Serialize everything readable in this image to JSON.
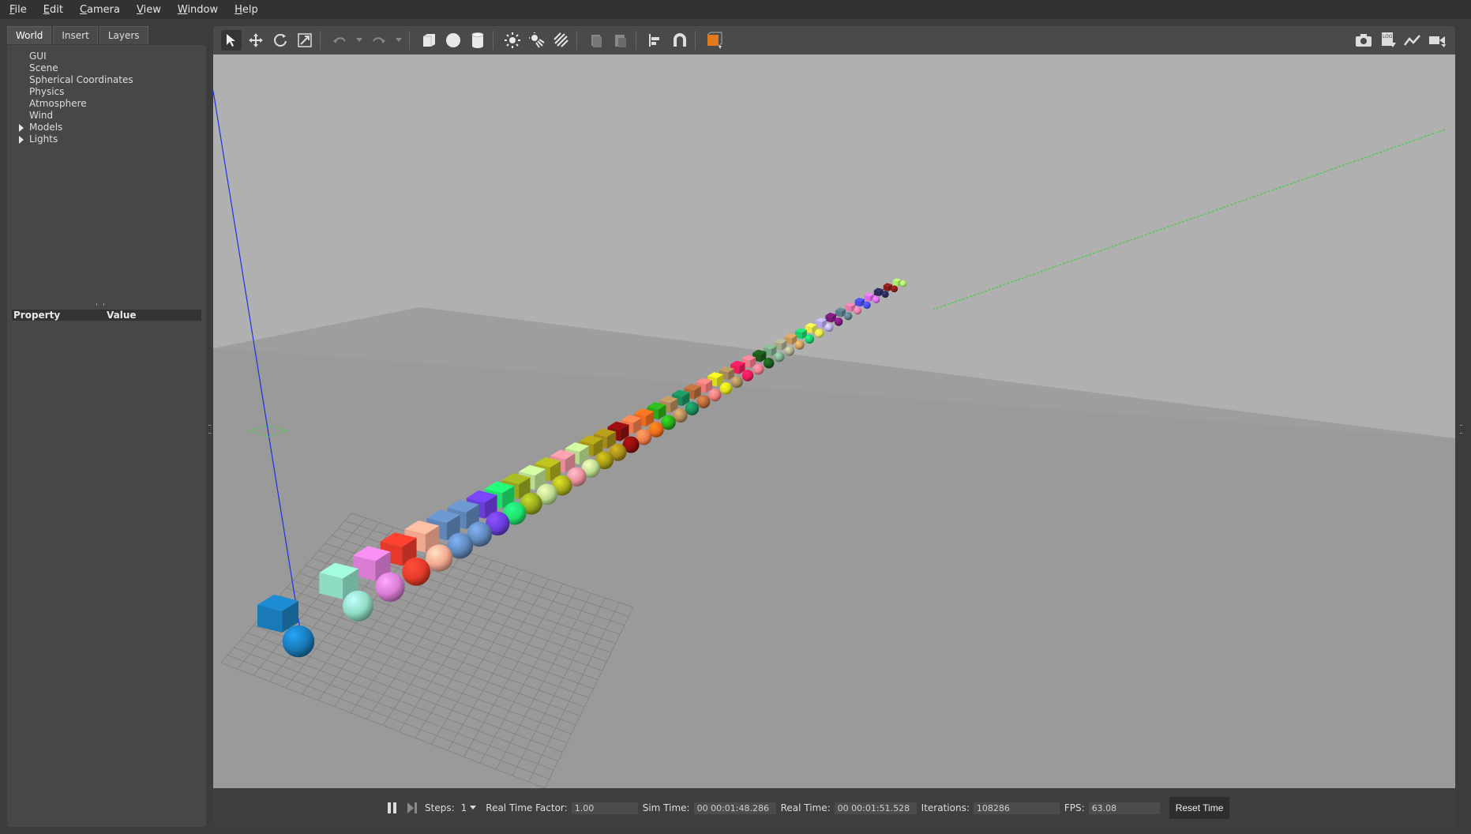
{
  "menu": [
    "File",
    "Edit",
    "Camera",
    "View",
    "Window",
    "Help"
  ],
  "left_panel": {
    "tabs": [
      "World",
      "Insert",
      "Layers"
    ],
    "active_tab": "World",
    "tree": [
      {
        "label": "GUI",
        "expandable": false
      },
      {
        "label": "Scene",
        "expandable": false
      },
      {
        "label": "Spherical Coordinates",
        "expandable": false
      },
      {
        "label": "Physics",
        "expandable": false
      },
      {
        "label": "Atmosphere",
        "expandable": false
      },
      {
        "label": "Wind",
        "expandable": false
      },
      {
        "label": "Models",
        "expandable": true
      },
      {
        "label": "Lights",
        "expandable": true
      }
    ],
    "property_header": {
      "property": "Property",
      "value": "Value"
    }
  },
  "toolbar": {
    "left_icons": [
      "select-icon",
      "translate-icon",
      "rotate-icon",
      "scale-icon",
      "undo-icon",
      "undo-dropdown-icon",
      "redo-icon",
      "redo-dropdown-icon",
      "box-icon",
      "sphere-icon",
      "cylinder-icon",
      "point-light-icon",
      "spot-light-icon",
      "directional-light-icon",
      "copy-icon",
      "paste-icon",
      "align-icon",
      "snap-icon",
      "view-angle-icon"
    ],
    "right_icons": [
      "screenshot-icon",
      "log-icon",
      "plot-icon",
      "record-video-icon"
    ],
    "log_label": "LOG"
  },
  "scene": {
    "sky_color": "#b0b0b0",
    "ground_color": "#999999",
    "model_colors": [
      "#1a7ab8",
      "#8fdcc4",
      "#d97cd4",
      "#e53a2a",
      "#f2a890",
      "#5f86b8",
      "#5f86b8",
      "#6a3ddd",
      "#1fe06a",
      "#96a51f",
      "#b9dc8e",
      "#a7ab1c",
      "#e88e9a",
      "#b9dc8e",
      "#a49616",
      "#a48a1a",
      "#8a0d0d",
      "#ee7a4a",
      "#ee6a1a",
      "#2aa81a",
      "#b0885a",
      "#1a8a5a",
      "#b0683a",
      "#ee7a7a",
      "#dddd1a",
      "#a88a5a",
      "#ee1a5a",
      "#ee7a8a",
      "#1a5a1a",
      "#7aa88a",
      "#a8a88a",
      "#c89a5a",
      "#1acc6a",
      "#e8e84a",
      "#b8a8e8",
      "#7a1a7a",
      "#5a7a8a",
      "#e87aa8",
      "#4a4aee",
      "#dd6aee",
      "#2a2a5a",
      "#8a1a1a",
      "#a8ee6a"
    ]
  },
  "status": {
    "steps_label": "Steps:",
    "steps_value": "1",
    "rtf_label": "Real Time Factor:",
    "rtf_value": "1.00",
    "sim_time_label": "Sim Time:",
    "sim_time_value": "00 00:01:48.286",
    "real_time_label": "Real Time:",
    "real_time_value": "00 00:01:51.528",
    "iterations_label": "Iterations:",
    "iterations_value": "108286",
    "fps_label": "FPS:",
    "fps_value": "63.08",
    "reset_label": "Reset Time"
  }
}
